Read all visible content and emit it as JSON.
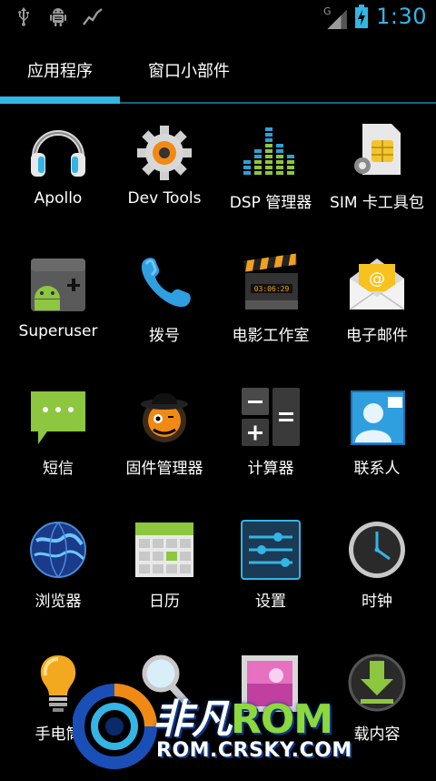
{
  "status_bar": {
    "left_icons": [
      "usb-icon",
      "android-debug-icon",
      "activity-graph-icon"
    ],
    "right_icons": [
      "signal-icon",
      "battery-charging-icon"
    ],
    "time": "1:30",
    "accent_color": "#33b5e5"
  },
  "tabs": [
    {
      "label": "应用程序",
      "selected": true
    },
    {
      "label": "窗口小部件",
      "selected": false
    }
  ],
  "apps": [
    {
      "label": "Apollo",
      "icon": "headphones-icon"
    },
    {
      "label": "Dev Tools",
      "icon": "gear-dev-tools-icon"
    },
    {
      "label": "DSP 管理器",
      "icon": "equalizer-icon"
    },
    {
      "label": "SIM 卡工具包",
      "icon": "sim-card-icon"
    },
    {
      "label": "Superuser",
      "icon": "android-superuser-icon"
    },
    {
      "label": "拨号",
      "icon": "phone-icon"
    },
    {
      "label": "电影工作室",
      "icon": "clapperboard-icon"
    },
    {
      "label": "电子邮件",
      "icon": "email-icon"
    },
    {
      "label": "短信",
      "icon": "message-bubble-icon"
    },
    {
      "label": "固件管理器",
      "icon": "rom-manager-icon"
    },
    {
      "label": "计算器",
      "icon": "calculator-icon"
    },
    {
      "label": "联系人",
      "icon": "contacts-icon"
    },
    {
      "label": "浏览器",
      "icon": "globe-icon"
    },
    {
      "label": "日历",
      "icon": "calendar-icon"
    },
    {
      "label": "设置",
      "icon": "settings-sliders-icon"
    },
    {
      "label": "时钟",
      "icon": "clock-icon"
    },
    {
      "label": "手电筒",
      "icon": "lightbulb-icon"
    },
    {
      "label": "",
      "icon": "search-magnifier-icon"
    },
    {
      "label": "",
      "icon": "gallery-icon"
    },
    {
      "label": "下载内容",
      "icon": "download-icon"
    }
  ],
  "visible_partial_labels": {
    "row5_col1": "手电筒",
    "row5_col4": "载内容"
  },
  "watermark": {
    "brand_cn": "非凡",
    "brand_rom": "ROM",
    "url": "ROM.CRSKY.COM"
  }
}
